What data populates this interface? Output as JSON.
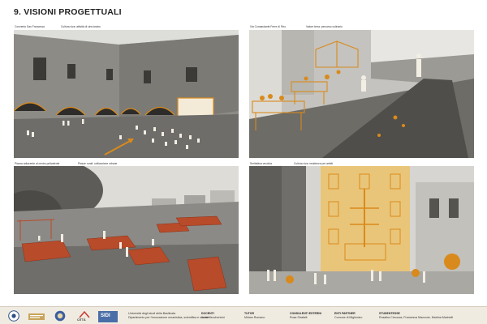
{
  "page": {
    "title": "9. VISIONI PROGETTUALI"
  },
  "panels": [
    {
      "captions": [
        "Convento San Francesco",
        "Cultura viva: attività di cine-teatro"
      ]
    },
    {
      "captions": [
        "Via Comandante Ferre di Fino",
        "Valore terra: percorso culinario"
      ]
    },
    {
      "captions": [
        "Piazza adiacente al centro polivalente",
        "Piazze rurali: coltivazione urbane"
      ]
    },
    {
      "captions": [
        "Seritabina vecchia",
        "Cultura viva: residenze per artisti"
      ]
    }
  ],
  "footer": {
    "logos": [
      "unibas-logo",
      "dicem-logo",
      "emblem-logo",
      "citta-logo",
      "siti-logo"
    ],
    "logo_text": [
      "CITTÀ",
      "SIDI"
    ],
    "university": [
      "Università degli studi della Basilicata",
      "Dipartimento per l'innovazione umanistica, scientifica e sociale"
    ],
    "docenti": {
      "label": "DOCENTI",
      "names": "Ilaria Mecchericini"
    },
    "tutor": {
      "label": "TUTOR",
      "names": "Miriam Romano"
    },
    "consulenti": {
      "label": "CONSULENTI ESTERNI",
      "names": "Rosa Strafalli"
    },
    "enti": {
      "label": "ENTI PARTNER",
      "names": "Comune di Miglionico"
    },
    "studenti": {
      "label": "STUDENTESSE",
      "names": "Rosalba Cirsuoca, Francesca Mazzone, Martina Marinelli"
    }
  },
  "colors": {
    "accent": "#d98a1c",
    "accent_red": "#b84b2a",
    "photo_gray": "#8a8a88",
    "footer_bg": "#f0ebe1"
  }
}
